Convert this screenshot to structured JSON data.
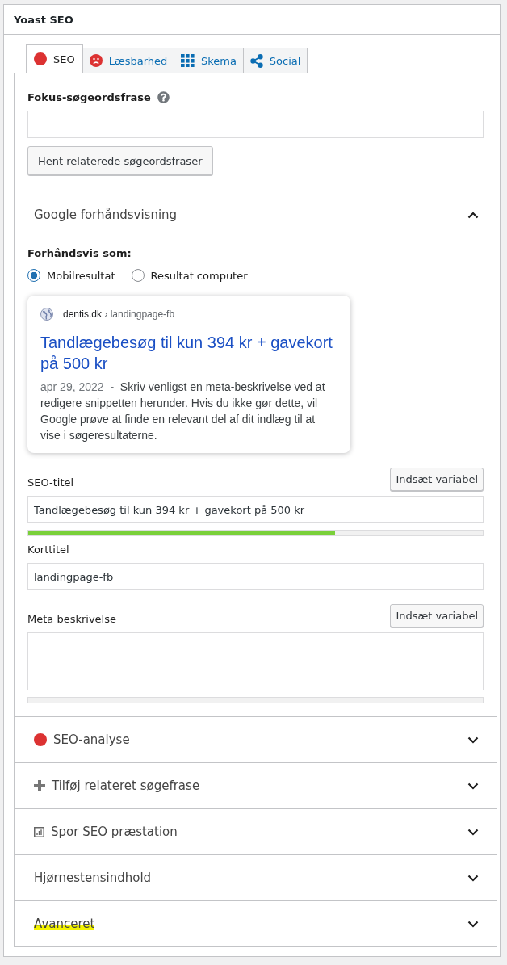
{
  "panel": {
    "title": "Yoast SEO"
  },
  "tabs": [
    {
      "label": "SEO",
      "kind": "score",
      "color": "#dc3232",
      "selected": true
    },
    {
      "label": "Læsbarhed",
      "kind": "face",
      "color": "#dc3232",
      "selected": false
    },
    {
      "label": "Skema",
      "kind": "grid",
      "selected": false
    },
    {
      "label": "Social",
      "kind": "share",
      "selected": false
    }
  ],
  "focus_keyphrase": {
    "label": "Fokus-søgeordsfrase",
    "button": "Hent relaterede søgeordsfraser"
  },
  "google_preview": {
    "title": "Google forhåndsvisning",
    "expanded": true,
    "preview_as_label": "Forhåndsvis som:",
    "options": [
      {
        "label": "Mobilresultat",
        "selected": true
      },
      {
        "label": "Resultat computer",
        "selected": false
      }
    ],
    "snippet": {
      "domain": "dentis.dk",
      "path": "› landingpage-fb",
      "title": "Tandlægebesøg til kun 394 kr + gavekort på 500 kr",
      "date": "apr 29, 2022",
      "separator": "-",
      "description": "Skriv venligst en meta-beskrivelse ved at redigere snippetten herunder. Hvis du ikke gør dette, vil Google prøve at finde en relevant del af dit indlæg til at vise i søgeresultaterne."
    },
    "fields": [
      {
        "label": "SEO-titel",
        "button": "Indsæt variabel",
        "kind": "input",
        "value": "Tandlægebesøg til kun 394 kr + gavekort på 500 kr",
        "meter": true,
        "level": 0.675
      },
      {
        "label": "Korttitel",
        "kind": "input",
        "value": "landingpage-fb"
      },
      {
        "label": "Meta beskrivelse",
        "button": "Indsæt variabel",
        "kind": "textarea",
        "meter": true
      }
    ]
  },
  "sections": [
    {
      "title": "SEO-analyse",
      "kind": "score",
      "color": "#dc3232",
      "expanded": false,
      "highlighted": false
    },
    {
      "title": "Tilføj relateret søgefrase",
      "kind": "add",
      "expanded": false,
      "highlighted": false
    },
    {
      "title": "Spor SEO præstation",
      "kind": "chart",
      "expanded": false,
      "highlighted": false
    },
    {
      "title": "Hjørnestensindhold",
      "kind": "plain",
      "expanded": false,
      "highlighted": false
    },
    {
      "title": "Avanceret",
      "kind": "plain",
      "expanded": false,
      "highlighted": true
    }
  ]
}
